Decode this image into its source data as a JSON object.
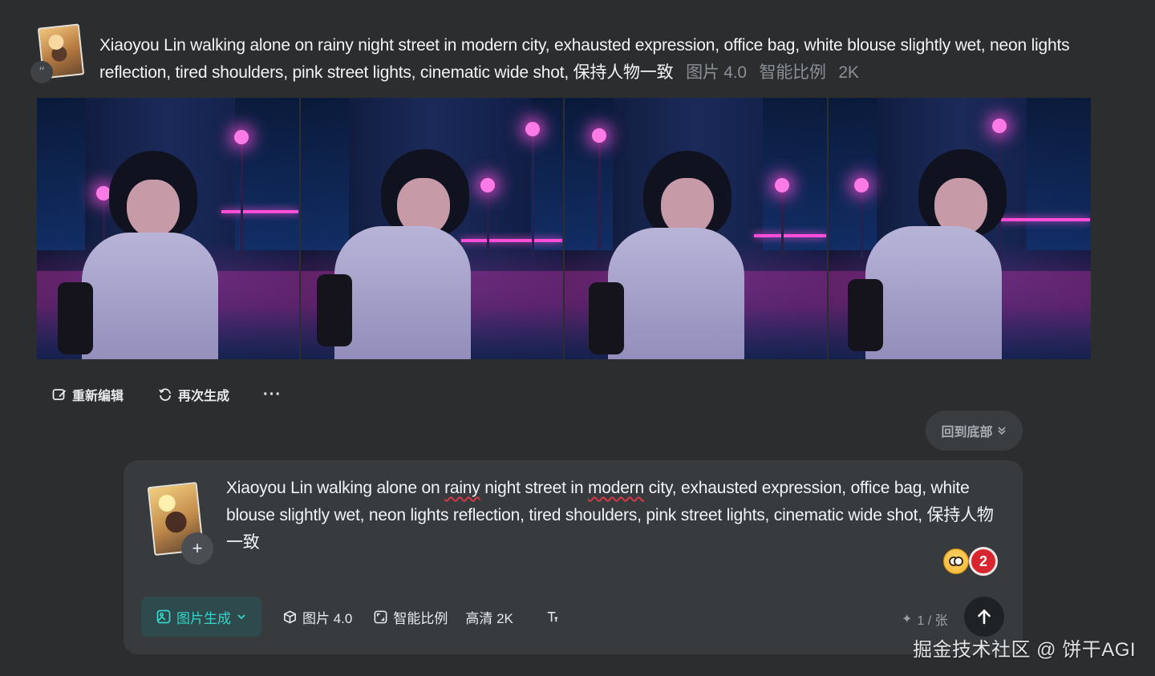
{
  "prompt": {
    "text": "Xiaoyou Lin walking alone on rainy night street in modern city, exhausted expression, office bag, white blouse slightly wet, neon lights reflection, tired shoulders, pink street lights, cinematic wide shot, 保持人物一致",
    "model": "图片 4.0",
    "ratio": "智能比例",
    "resolution": "2K",
    "quote_icon": "quote-icon"
  },
  "images": [
    {
      "label": "generated-image-1"
    },
    {
      "label": "generated-image-2"
    },
    {
      "label": "generated-image-3"
    },
    {
      "label": "generated-image-4"
    }
  ],
  "actions": {
    "reedit": "重新编辑",
    "regenerate": "再次生成",
    "more": "···"
  },
  "scroll_bottom": "回到底部",
  "composer": {
    "text_parts": [
      "Xiaoyou Lin walking alone on ",
      "rainy",
      " night street in ",
      "modern",
      " city, exhausted expression, office bag, white blouse slightly wet, neon lights reflection, tired shoulders, pink street lights, cinematic wide shot, 保持人物一致"
    ],
    "add_icon": "+",
    "emoji_count": "2",
    "mode": "图片生成",
    "model": "图片 4.0",
    "ratio": "智能比例",
    "quality": "高清 2K",
    "credits": "1 / 张",
    "colors": {
      "accent": "#35d3c9",
      "mode_bg": "#2f4a4d",
      "badge": "#d7262f"
    }
  },
  "watermark": "掘金技术社区 @ 饼干AGI"
}
